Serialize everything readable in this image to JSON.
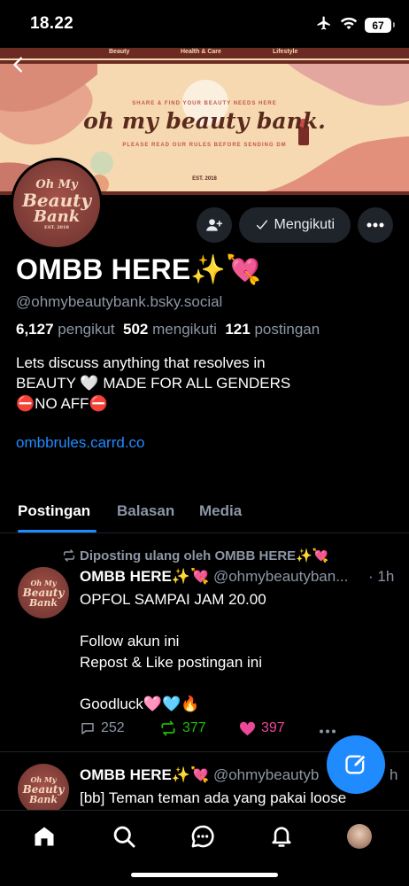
{
  "status_bar": {
    "time": "18.22",
    "battery": "67"
  },
  "banner": {
    "nav": [
      "Beauty",
      "Health & Care",
      "Lifestyle"
    ],
    "tagline": "SHARE & FIND YOUR BEAUTY NEEDS HERE",
    "title": "oh my beauty bank.",
    "subtitle": "PLEASE READ OUR RULES BEFORE SENDING DM",
    "est": "EST. 2018"
  },
  "avatar_text": {
    "line1": "Oh My",
    "line2": "Beauty",
    "line3": "Bank",
    "line4": "EST. 2018"
  },
  "actions": {
    "follow_label": "Mengikuti"
  },
  "profile": {
    "name": "OMBB HERE✨💘",
    "handle": "@ohmybeautybank.bsky.social",
    "followers_count": "6,127",
    "followers_label": "pengikut",
    "following_count": "502",
    "following_label": "mengikuti",
    "posts_count": "121",
    "posts_label": "postingan",
    "bio_line1": "Lets discuss anything that resolves in",
    "bio_line2": "BEAUTY 🤍 MADE FOR ALL GENDERS",
    "bio_line3": "⛔NO AFF⛔",
    "link": "ombbrules.carrd.co"
  },
  "tabs": [
    "Postingan",
    "Balasan",
    "Media"
  ],
  "posts": [
    {
      "repost_label": "Diposting ulang oleh OMBB HERE✨💘",
      "author": "OMBB HERE✨💘",
      "handle": "@ohmybeautyban...",
      "time": "· 1h",
      "text": "OPFOL SAMPAI JAM 20.00\n\nFollow akun ini\nRepost & Like postingan ini\n\nGoodluck🩷🩵🔥",
      "replies": "252",
      "reposts": "377",
      "likes": "397"
    },
    {
      "author": "OMBB HERE✨💘",
      "handle": "@ohmybeautyb",
      "time": "h",
      "text": "[bb] Teman teman ada yang pakai loose"
    }
  ],
  "colors": {
    "accent": "#208bfe",
    "repost": "#20bc07",
    "like": "#ec4899",
    "muted": "#8c96a5"
  },
  "icons": [
    "airplane-icon",
    "wifi-icon",
    "battery-icon",
    "back-icon",
    "add-user-icon",
    "check-icon",
    "more-icon",
    "repost-icon",
    "reply-icon",
    "like-icon",
    "compose-icon",
    "home-icon",
    "search-icon",
    "chat-icon",
    "bell-icon"
  ]
}
